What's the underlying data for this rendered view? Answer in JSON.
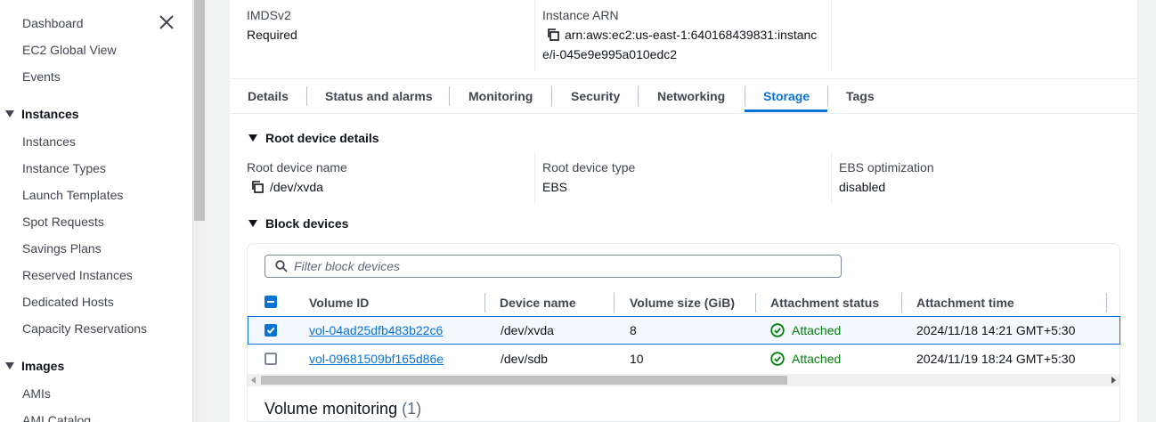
{
  "sidebar": {
    "items_top": [
      "Dashboard",
      "EC2 Global View",
      "Events"
    ],
    "sections": [
      {
        "title": "Instances",
        "items": [
          "Instances",
          "Instance Types",
          "Launch Templates",
          "Spot Requests",
          "Savings Plans",
          "Reserved Instances",
          "Dedicated Hosts",
          "Capacity Reservations"
        ]
      },
      {
        "title": "Images",
        "items": [
          "AMIs",
          "AMI Catalog"
        ]
      }
    ],
    "close_icon": "close-icon"
  },
  "details": {
    "imds_label": "IMDSv2",
    "imds_value": "Required",
    "arn_label": "Instance ARN",
    "arn_line1": "arn:aws:ec2:us-east-1:640168439831:instanc",
    "arn_line2": "e/i-045e9e995a010edc2"
  },
  "tabs": [
    "Details",
    "Status and alarms",
    "Monitoring",
    "Security",
    "Networking",
    "Storage",
    "Tags"
  ],
  "active_tab": "Storage",
  "root_device": {
    "heading": "Root device details",
    "name_label": "Root device name",
    "name_value": "/dev/xvda",
    "type_label": "Root device type",
    "type_value": "EBS",
    "ebs_label": "EBS optimization",
    "ebs_value": "disabled"
  },
  "block_devices": {
    "heading": "Block devices",
    "filter_placeholder": "Filter block devices",
    "columns": [
      "Volume ID",
      "Device name",
      "Volume size (GiB)",
      "Attachment status",
      "Attachment time"
    ],
    "rows": [
      {
        "volume_id": "vol-04ad25dfb483b22c6",
        "device": "/dev/xvda",
        "size": "8",
        "status": "Attached",
        "time": "2024/11/18 14:21 GMT+5:30",
        "selected": true
      },
      {
        "volume_id": "vol-09681509bf165d86e",
        "device": "/dev/sdb",
        "size": "10",
        "status": "Attached",
        "time": "2024/11/19 18:24 GMT+5:30",
        "selected": false
      }
    ]
  },
  "volume_monitoring": {
    "title": "Volume monitoring",
    "count": "(1)"
  },
  "colors": {
    "accent": "#0972d3",
    "success": "#037f0c"
  }
}
